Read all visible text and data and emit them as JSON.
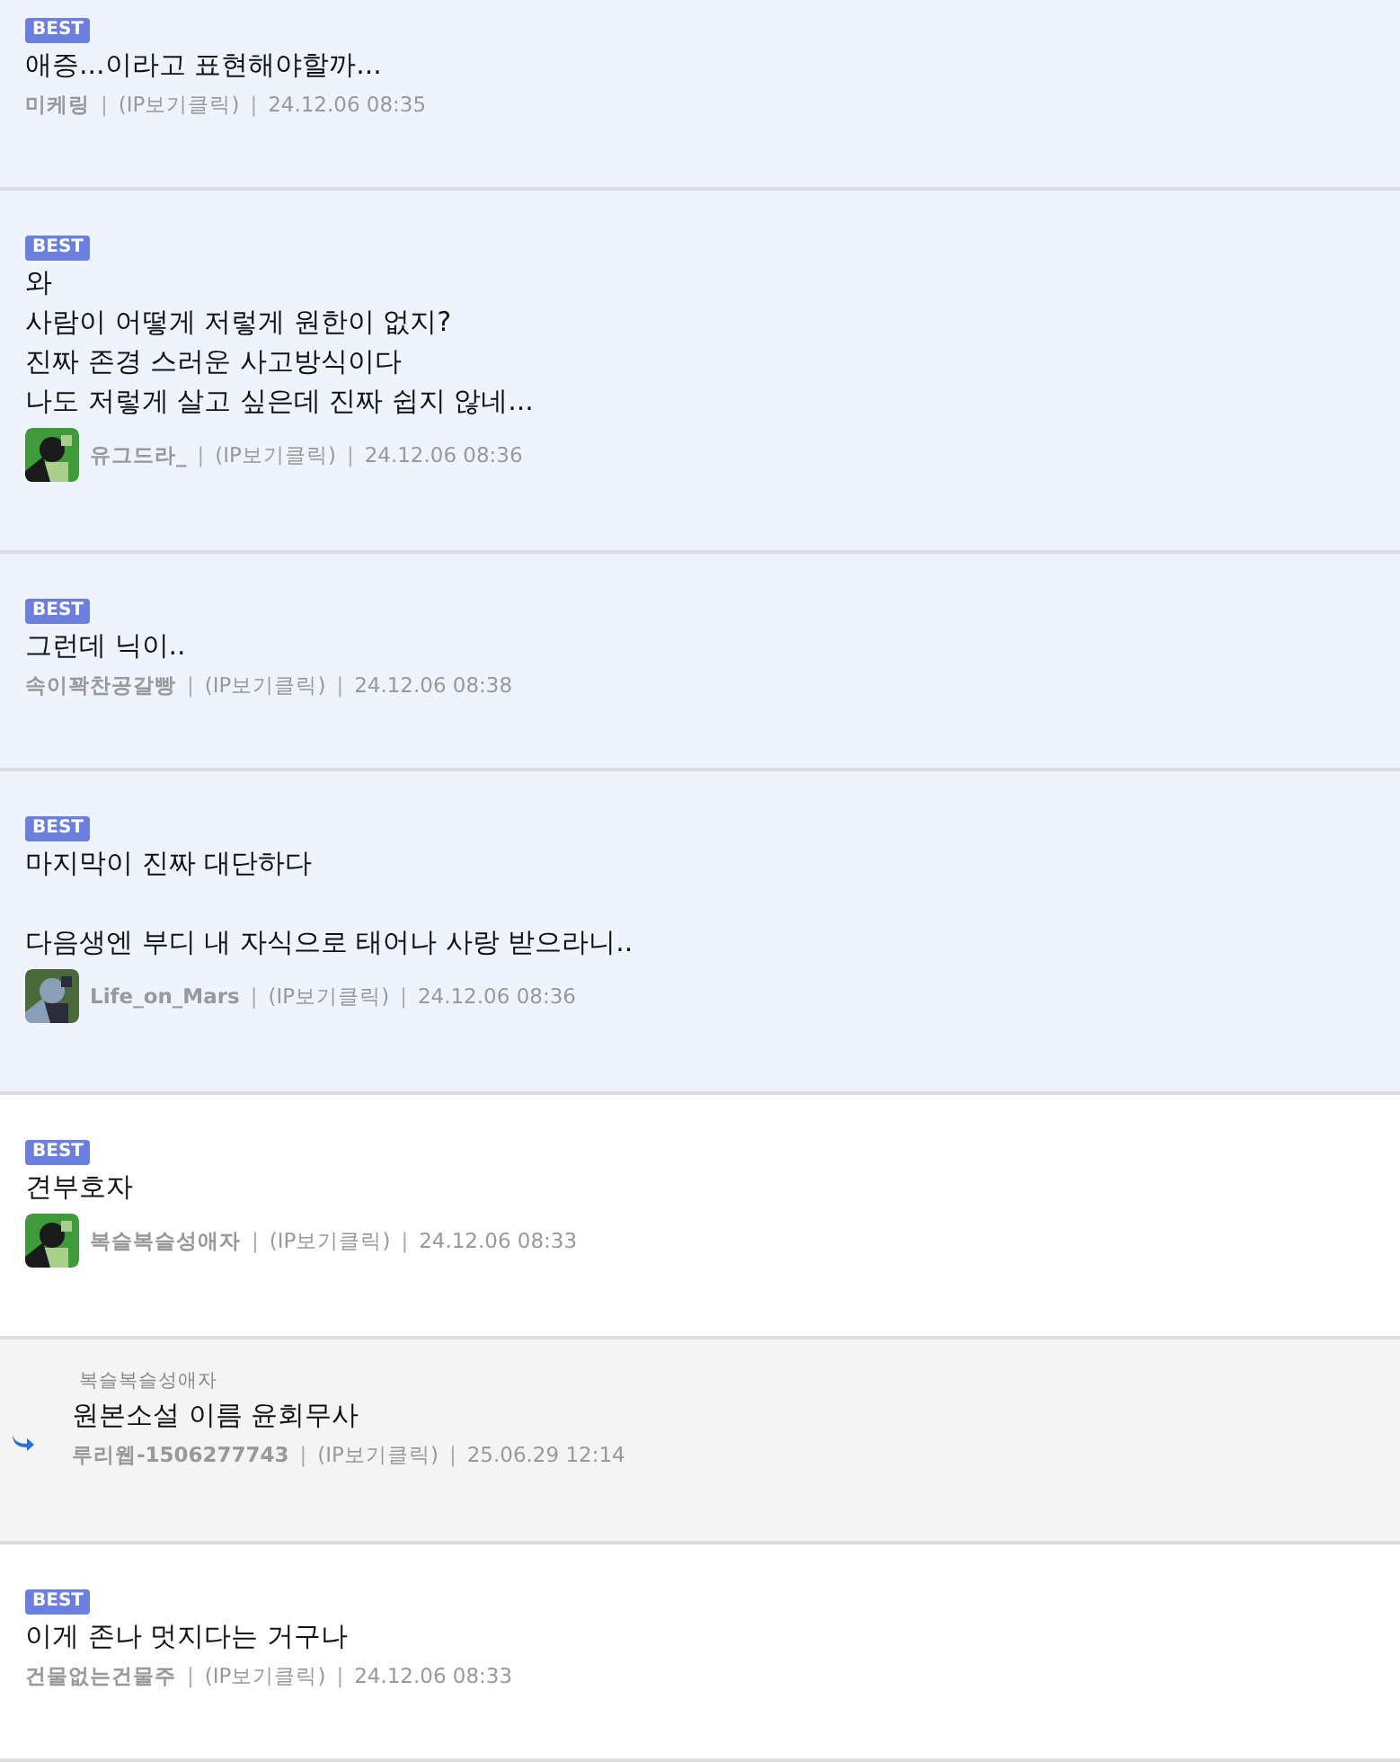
{
  "comments": [
    {
      "kind": "best",
      "highlighted": true,
      "badge": "BEST",
      "text": "애증...이라고 표현해야할까...",
      "avatar": false,
      "author": "미케링",
      "separator": "|",
      "ip": "(IP보기클릭)",
      "date": "24.12.06 08:35"
    },
    {
      "kind": "best",
      "highlighted": true,
      "badge": "BEST",
      "text": "와\n사람이 어떻게 저렇게 원한이 없지?\n진짜 존경 스러운 사고방식이다\n나도 저렇게 살고 싶은데 진짜 쉽지 않네...",
      "avatar": true,
      "author": "유그드라_",
      "separator": "|",
      "ip": "(IP보기클릭)",
      "date": "24.12.06 08:36"
    },
    {
      "kind": "best",
      "highlighted": true,
      "badge": "BEST",
      "text": "그런데 닉이..",
      "avatar": false,
      "author": "속이꽉찬공갈빵",
      "separator": "|",
      "ip": "(IP보기클릭)",
      "date": "24.12.06 08:38"
    },
    {
      "kind": "best",
      "highlighted": true,
      "badge": "BEST",
      "text": "마지막이 진짜 대단하다\n\n다음생엔 부디 내 자식으로 태어나 사랑 받으라니..",
      "avatar": true,
      "author": "Life_on_Mars",
      "separator": "|",
      "ip": "(IP보기클릭)",
      "date": "24.12.06 08:36"
    },
    {
      "kind": "best",
      "highlighted": false,
      "badge": "BEST",
      "text": "견부호자",
      "avatar": true,
      "author": "복슬복슬성애자",
      "separator": "|",
      "ip": "(IP보기클릭)",
      "date": "24.12.06 08:33"
    },
    {
      "kind": "reply",
      "reply_to": "복슬복슬성애자",
      "text": "원본소설 이름 윤회무사",
      "avatar": false,
      "author": "루리웹-1506277743",
      "separator": "|",
      "ip": "(IP보기클릭)",
      "date": "25.06.29 12:14"
    },
    {
      "kind": "best",
      "highlighted": false,
      "badge": "BEST",
      "text": "이게 존나 멋지다는 거구나",
      "avatar": false,
      "author": "건물없는건물주",
      "separator": "|",
      "ip": "(IP보기클릭)",
      "date": "24.12.06 08:33"
    }
  ]
}
